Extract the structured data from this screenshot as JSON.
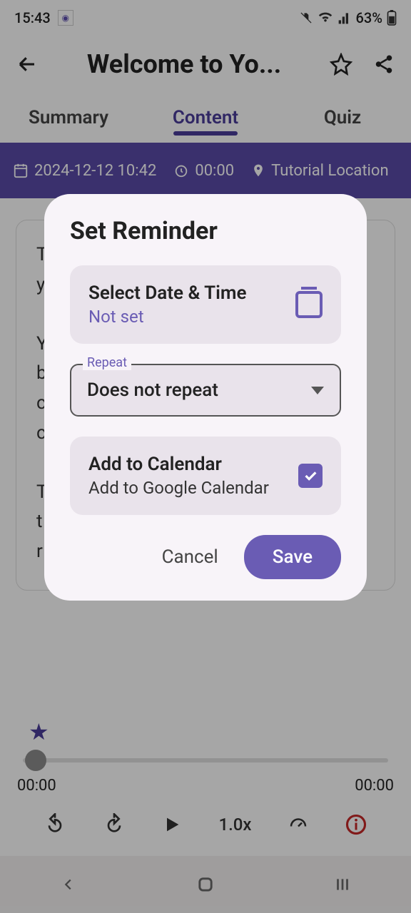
{
  "status": {
    "time": "15:43",
    "battery": "63%"
  },
  "appbar": {
    "title": "Welcome to Yo..."
  },
  "tabs": {
    "summary": "Summary",
    "content": "Content",
    "quiz": "Quiz"
  },
  "infobar": {
    "date": "2024-12-12 10:42",
    "duration": "00:00",
    "location": "Tutorial Location"
  },
  "player": {
    "currentTime": "00:00",
    "totalTime": "00:00",
    "speed": "1.0x"
  },
  "modal": {
    "title": "Set Reminder",
    "datetime": {
      "label": "Select Date & Time",
      "value": "Not set"
    },
    "repeat": {
      "label": "Repeat",
      "value": "Does not repeat"
    },
    "calendar": {
      "label": "Add to Calendar",
      "sub": "Add to Google Calendar",
      "checked": true
    },
    "cancel": "Cancel",
    "save": "Save"
  }
}
